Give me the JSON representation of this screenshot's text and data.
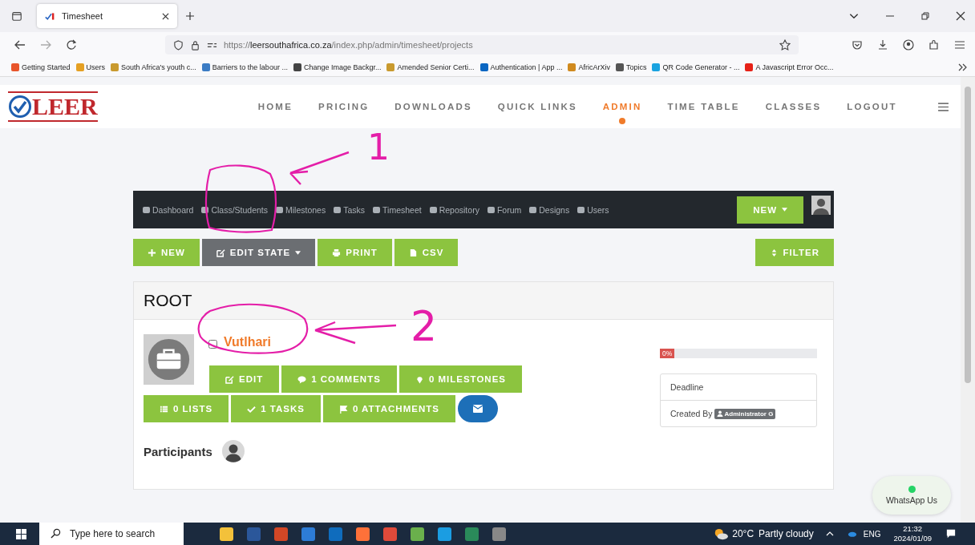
{
  "browser": {
    "tabs": [
      {
        "title": "Timesheet",
        "selected": true
      }
    ],
    "url": {
      "scheme": "https://",
      "domain": "leersouthafrica.co.za",
      "path": "/index.php/admin/timesheet/projects"
    },
    "bookmarks": [
      {
        "label": "Getting Started",
        "color": "#e8552b"
      },
      {
        "label": "Users",
        "color": "#e5a023"
      },
      {
        "label": "South Africa's youth c...",
        "color": "#c99a2e"
      },
      {
        "label": "Barriers to the labour ...",
        "color": "#3b7cc4"
      },
      {
        "label": "Change Image Backgr...",
        "color": "#444444"
      },
      {
        "label": "Amended Senior Certi...",
        "color": "#c99a2e"
      },
      {
        "label": "Authentication | App ...",
        "color": "#0a66c2"
      },
      {
        "label": "AfricArXiv",
        "color": "#d08a1e"
      },
      {
        "label": "Topics",
        "color": "#555555"
      },
      {
        "label": "QR Code Generator - ...",
        "color": "#1aa3e0"
      },
      {
        "label": "A Javascript Error Occ...",
        "color": "#e62117"
      }
    ]
  },
  "site": {
    "logo": "LEER",
    "nav": [
      {
        "label": "HOME",
        "selected": false
      },
      {
        "label": "PRICING",
        "selected": false
      },
      {
        "label": "DOWNLOADS",
        "selected": false
      },
      {
        "label": "QUICK LINKS",
        "selected": false
      },
      {
        "label": "ADMIN",
        "selected": true
      },
      {
        "label": "TIME TABLE",
        "selected": false
      },
      {
        "label": "CLASSES",
        "selected": false
      },
      {
        "label": "LOGOUT",
        "selected": false
      }
    ]
  },
  "app_nav": {
    "items": [
      "Dashboard",
      "Class/Students",
      "Milestones",
      "Tasks",
      "Timesheet",
      "Repository",
      "Forum",
      "Designs",
      "Users"
    ],
    "new_button": "NEW"
  },
  "actions": [
    {
      "label": "NEW",
      "kind": "plus"
    },
    {
      "label": "EDIT STATE",
      "kind": "edit"
    },
    {
      "label": "PRINT",
      "kind": "print"
    },
    {
      "label": "CSV",
      "kind": "file"
    }
  ],
  "filter_button": "FILTER",
  "card": {
    "title": "ROOT",
    "project": {
      "name": "Vutlhari",
      "checked": false,
      "buttons": [
        {
          "label": "EDIT",
          "kind": "edit"
        },
        {
          "label": "1 COMMENTS",
          "kind": "comment"
        },
        {
          "label": "0 MILESTONES",
          "kind": "pin"
        },
        {
          "label": "0 LISTS",
          "kind": "list"
        },
        {
          "label": "1 TASKS",
          "kind": "check"
        },
        {
          "label": "0 ATTACHMENTS",
          "kind": "flag"
        }
      ],
      "progress": {
        "label": "0%",
        "level": 0
      },
      "deadline_label": "Deadline",
      "created_by_label": "Created By",
      "creator": "Administrator G"
    },
    "participants_label": "Participants"
  },
  "whatsapp": "WhatsApp Us",
  "annotations": [
    {
      "label": "1"
    },
    {
      "label": "2"
    }
  ],
  "taskbar": {
    "search_placeholder": "Type here to search",
    "temperature": "20°C",
    "weather": "Partly cloudy",
    "language": "ENG",
    "time": "21:32",
    "date": "2024/01/09"
  }
}
